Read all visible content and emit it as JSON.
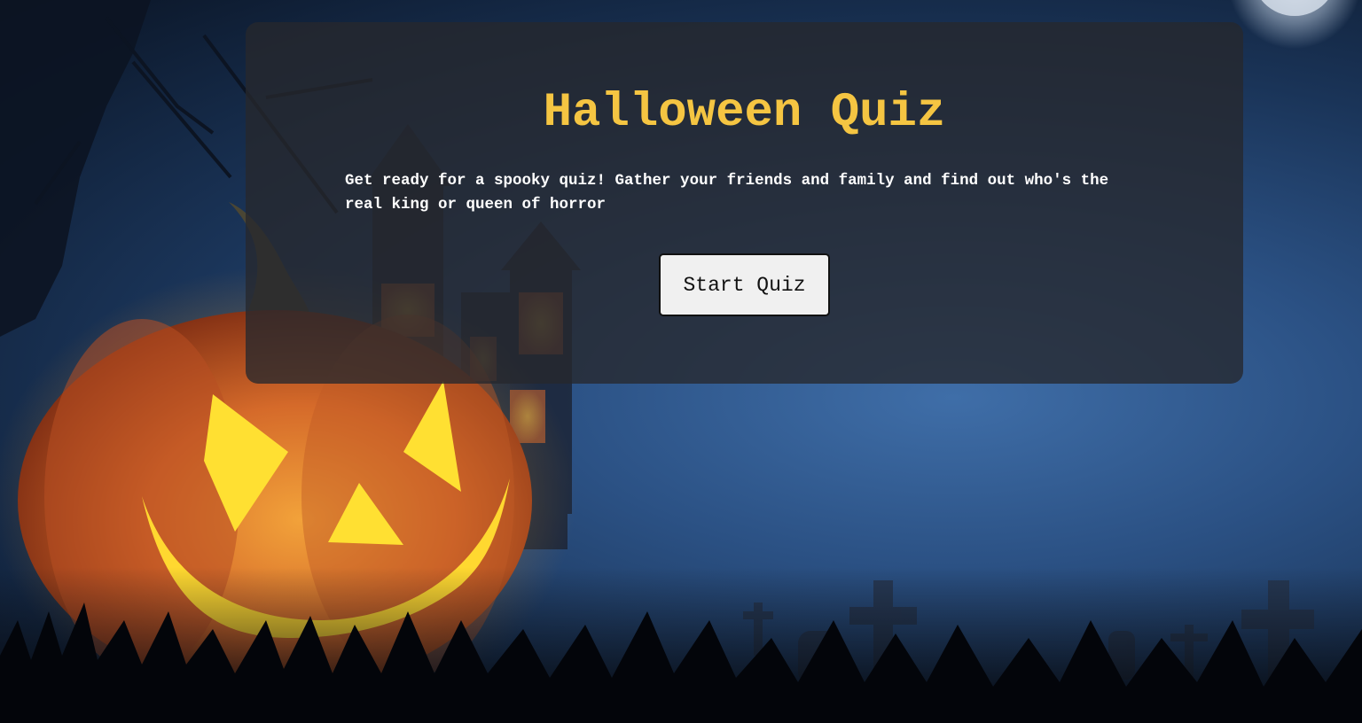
{
  "page": {
    "title": "Halloween Quiz",
    "intro": "Get ready for a spooky quiz! Gather your friends and family and find out who's the real king or queen of horror",
    "start_button": "Start Quiz"
  },
  "colors": {
    "title": "#f5c542",
    "card": "#26282d",
    "button_bg": "#f0f0f0",
    "sky": "#2b5184"
  },
  "background": {
    "scene": "halloween-night-graveyard",
    "elements": [
      "full-moon",
      "haunted-house",
      "jack-o-lantern",
      "bare-tree",
      "grass",
      "grave-crosses"
    ]
  }
}
